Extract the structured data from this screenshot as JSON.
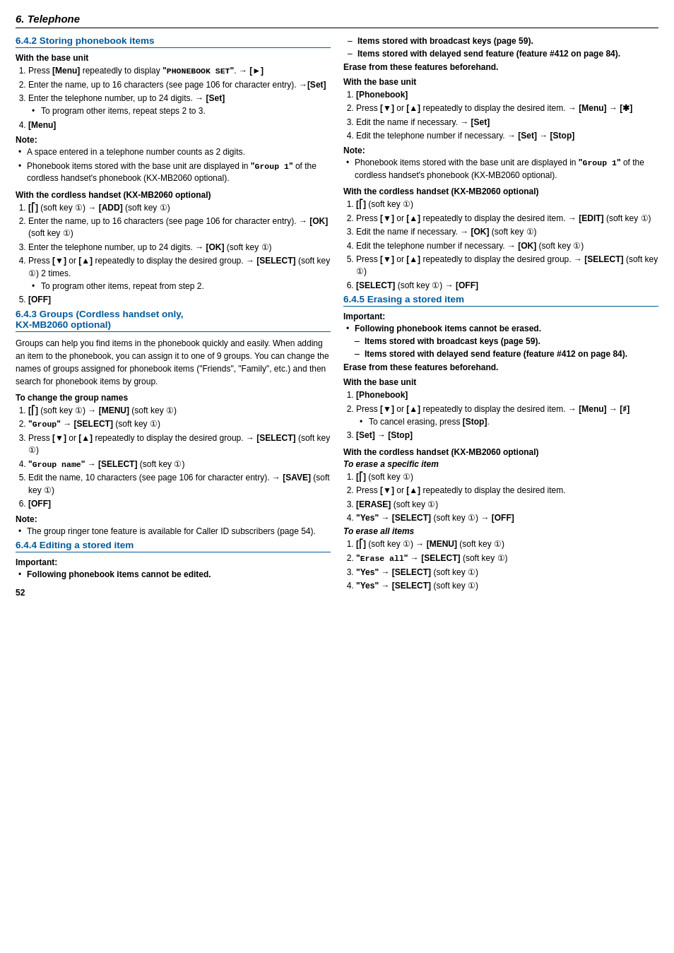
{
  "page": {
    "header": "6. Telephone",
    "page_number": "52",
    "left_col": {
      "sections": [
        {
          "id": "642",
          "title": "6.4.2 Storing phonebook items",
          "base_unit": {
            "heading": "With the base unit",
            "steps": [
              "Press <b>[Menu]</b> repeatedly to display <b>\"<code>PHONEBOOK SET</code>\"</b>. → <b>[►]</b>",
              "Enter the name, up to 16 characters (see page 106 for character entry). →<b>[Set]</b>",
              "Enter the telephone number, up to 24 digits. → <b>[Set]</b>",
              "sub: To program other items, repeat steps 2 to 3.",
              "<b>[Menu]</b>"
            ],
            "note_heading": "Note:",
            "notes": [
              "A space entered in a telephone number counts as 2 digits.",
              "Phonebook items stored with the base unit are displayed in <b>\"<code>Group 1</code>\"</b> of the cordless handset's phonebook (KX-MB2060 optional)."
            ]
          },
          "cordless": {
            "heading": "With the cordless handset (KX-MB2060 optional)",
            "steps": [
              "<b>[<span>&#9121;</span>]</b> (soft key <span>①</span>) → <b>[ADD]</b> (soft key <span>①</span>)",
              "Enter the name, up to 16 characters (see page 106 for character entry). → <b>[OK]</b> (soft key <span>①</span>)",
              "Enter the telephone number, up to 24 digits. → <b>[OK]</b> (soft key <span>①</span>)",
              "Press <b>[▼]</b> or <b>[▲]</b> repeatedly to display the desired group. → <b>[SELECT]</b> (soft key <span>①</span>) 2 times.",
              "sub: To program other items, repeat from step 2.",
              "<b>[OFF]</b>"
            ]
          }
        },
        {
          "id": "643",
          "title": "6.4.3 Groups (Cordless handset only, KX-MB2060 optional)",
          "body": "Groups can help you find items in the phonebook quickly and easily. When adding an item to the phonebook, you can assign it to one of 9 groups. You can change the names of groups assigned for phonebook items (\"Friends\", \"Family\", etc.) and then search for phonebook items by group.",
          "change_group": {
            "heading": "To change the group names",
            "steps": [
              "<b>[<span>&#9121;</span>]</b> (soft key <span>①</span>) → <b>[MENU]</b> (soft key <span>①</span>)",
              "<b>\"<code>Group</code>\"</b> → <b>[SELECT]</b> (soft key <span>①</span>)",
              "Press <b>[▼]</b> or <b>[▲]</b> repeatedly to display the desired group. → <b>[SELECT]</b> (soft key <span>①</span>)",
              "<b>\"<code>Group name</code>\"</b> → <b>[SELECT]</b> (soft key <span>①</span>)",
              "Edit the name, 10 characters (see page 106 for character entry). → <b>[SAVE]</b> (soft key <span>①</span>)",
              "<b>[OFF]</b>"
            ],
            "note_heading": "Note:",
            "notes": [
              "The group ringer tone feature is available for Caller ID subscribers (page 54)."
            ]
          }
        },
        {
          "id": "644",
          "title": "6.4.4 Editing a stored item",
          "important_heading": "Important:",
          "important_notes": [
            "Following phonebook items cannot be edited."
          ]
        }
      ]
    },
    "right_col": {
      "sections_top": {
        "dash_items": [
          "Items stored with broadcast keys (page 59).",
          "Items stored with delayed send feature (feature #412 on page 84)."
        ],
        "erase_note": "Erase from these features beforehand.",
        "base_unit": {
          "heading": "With the base unit",
          "steps": [
            "<b>[Phonebook]</b>",
            "Press <b>[▼]</b> or <b>[▲]</b> repeatedly to display the desired item. → <b>[Menu]</b> → <b>[✱]</b>",
            "Edit the name if necessary. → <b>[Set]</b>",
            "Edit the telephone number if necessary. → <b>[Set]</b> → <b>[Stop]</b>"
          ],
          "note_heading": "Note:",
          "notes": [
            "Phonebook items stored with the base unit are displayed in <b>\"<code>Group 1</code>\"</b> of the cordless handset's phonebook (KX-MB2060 optional)."
          ]
        },
        "cordless": {
          "heading": "With the cordless handset (KX-MB2060 optional)",
          "steps": [
            "<b>[<span>&#9121;</span>]</b> (soft key <span>①</span>)",
            "Press <b>[▼]</b> or <b>[▲]</b> repeatedly to display the desired item. → <b>[EDIT]</b> (soft key <span>①</span>)",
            "Edit the name if necessary. → <b>[OK]</b> (soft key <span>①</span>)",
            "Edit the telephone number if necessary. → <b>[OK]</b> (soft key <span>①</span>)",
            "Press <b>[▼]</b> or <b>[▲]</b> repeatedly to display the desired group. → <b>[SELECT]</b> (soft key <span>①</span>)",
            "<b>[SELECT]</b> (soft key <span>①</span>) → <b>[OFF]</b>"
          ]
        }
      },
      "sections_bottom": {
        "id": "645",
        "title": "6.4.5 Erasing a stored item",
        "important_heading": "Important:",
        "important_notes_prefix": "Following phonebook items cannot be erased.",
        "dash_items": [
          "Items stored with broadcast keys (page 59).",
          "Items stored with delayed send feature (feature #412 on page 84)."
        ],
        "erase_note": "Erase from these features beforehand.",
        "base_unit": {
          "heading": "With the base unit",
          "steps": [
            "<b>[Phonebook]</b>",
            "Press <b>[▼]</b> or <b>[▲]</b> repeatedly to display the desired item. → <b>[Menu]</b> → <b>[♯]</b>",
            "sub: To cancel erasing, press <b>[Stop]</b>.",
            "<b>[Set]</b> → <b>[Stop]</b>"
          ]
        },
        "cordless_erase": {
          "heading": "With the cordless handset (KX-MB2060 optional)",
          "specific_heading": "To erase a specific item",
          "specific_steps": [
            "<b>[<span>&#9121;</span>]</b> (soft key <span>①</span>)",
            "Press <b>[▼]</b> or <b>[▲]</b> repeatedly to display the desired item.",
            "<b>[ERASE]</b> (soft key <span>①</span>)",
            "<b>\"Yes\"</b> → <b>[SELECT]</b> (soft key <span>①</span>) → <b>[OFF]</b>"
          ],
          "all_heading": "To erase all items",
          "all_steps": [
            "<b>[<span>&#9121;</span>]</b> (soft key <span>①</span>) → <b>[MENU]</b> (soft key <span>①</span>)",
            "<b>\"<code>Erase all</code>\"</b> → <b>[SELECT]</b> (soft key <span>①</span>)",
            "<b>\"Yes\"</b> → <b>[SELECT]</b> (soft key <span>①</span>)",
            "<b>\"Yes\"</b> → <b>[SELECT]</b> (soft key <span>①</span>)"
          ]
        }
      }
    }
  }
}
